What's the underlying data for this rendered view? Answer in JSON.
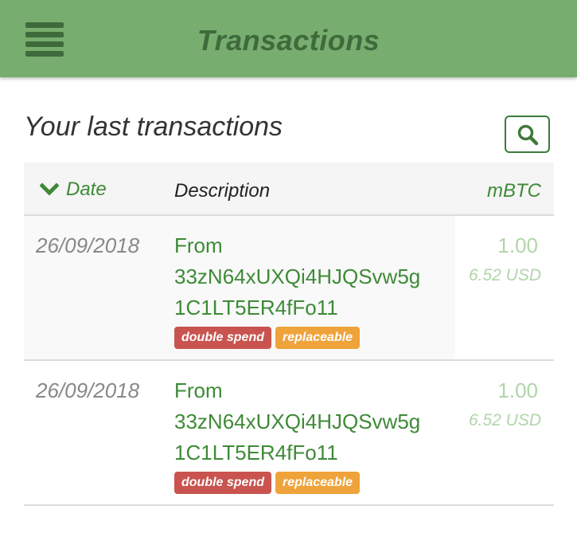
{
  "appbar": {
    "title": "Transactions",
    "menu_icon": "hamburger-menu-icon"
  },
  "section": {
    "title": "Your last transactions",
    "search_icon": "search-icon"
  },
  "table": {
    "headers": {
      "date": "Date",
      "description": "Description",
      "amount": "mBTC"
    },
    "sort_icon": "chevron-down-icon",
    "rows": [
      {
        "date": "26/09/2018",
        "desc_lines": [
          "From",
          "33zN64xUXQi4HJQSvw5g",
          "1C1LT5ER4fFo11"
        ],
        "badges": [
          "double spend",
          "replaceable"
        ],
        "amount": "1.00",
        "usd": "6.52 USD"
      },
      {
        "date": "26/09/2018",
        "desc_lines": [
          "From",
          "33zN64xUXQi4HJQSvw5g",
          "1C1LT5ER4fFo11"
        ],
        "badges": [
          "double spend",
          "replaceable"
        ],
        "amount": "1.00",
        "usd": "6.52 USD"
      }
    ]
  },
  "colors": {
    "appbar": "#77ad6f",
    "primary_green": "#3e8a37",
    "badge_double_spend": "#c9544f",
    "badge_replaceable": "#efa33b"
  }
}
